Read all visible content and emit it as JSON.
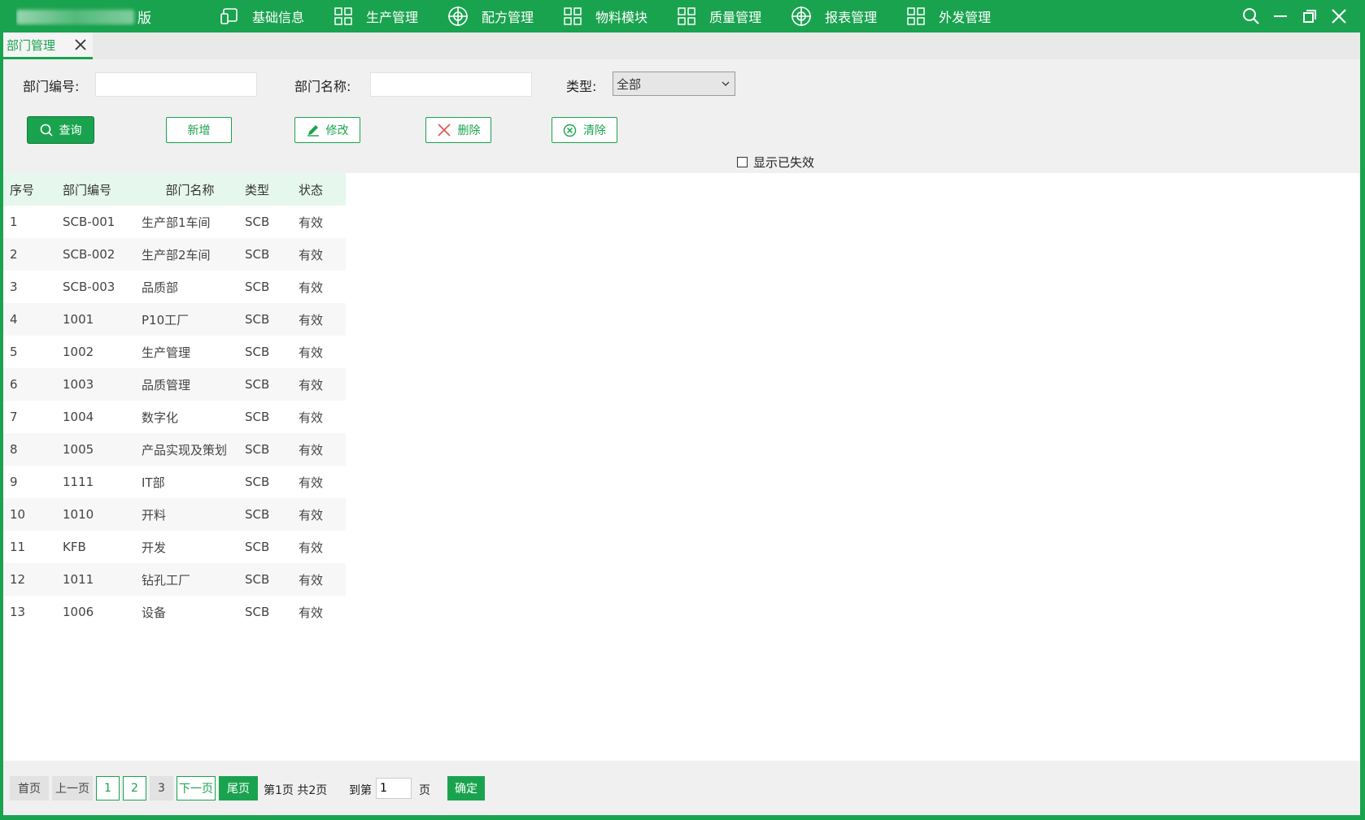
{
  "app": {
    "title_suffix": "版"
  },
  "menu": [
    {
      "label": "基础信息",
      "icon": "device-icon"
    },
    {
      "label": "生产管理",
      "icon": "grid-icon"
    },
    {
      "label": "配方管理",
      "icon": "target-icon"
    },
    {
      "label": "物料模块",
      "icon": "grid-icon"
    },
    {
      "label": "质量管理",
      "icon": "grid-icon"
    },
    {
      "label": "报表管理",
      "icon": "target-icon"
    },
    {
      "label": "外发管理",
      "icon": "grid-icon"
    }
  ],
  "tab": {
    "label": "部门管理"
  },
  "filter": {
    "dept_code_label": "部门编号:",
    "dept_code_value": "",
    "dept_name_label": "部门名称:",
    "dept_name_value": "",
    "type_label": "类型:",
    "type_value": "全部"
  },
  "buttons": {
    "query": "查询",
    "add": "新增",
    "edit": "修改",
    "delete": "删除",
    "clear": "清除"
  },
  "show_invalid_label": "显示已失效",
  "table": {
    "headers": [
      "序号",
      "部门编号",
      "部门名称",
      "类型",
      "状态"
    ],
    "rows": [
      [
        "1",
        "SCB-001",
        "生产部1车间",
        "SCB",
        "有效"
      ],
      [
        "2",
        "SCB-002",
        "生产部2车间",
        "SCB",
        "有效"
      ],
      [
        "3",
        "SCB-003",
        "品质部",
        "SCB",
        "有效"
      ],
      [
        "4",
        "1001",
        "P10工厂",
        "SCB",
        "有效"
      ],
      [
        "5",
        "1002",
        "生产管理",
        "SCB",
        "有效"
      ],
      [
        "6",
        "1003",
        "品质管理",
        "SCB",
        "有效"
      ],
      [
        "7",
        "1004",
        "数字化",
        "SCB",
        "有效"
      ],
      [
        "8",
        "1005",
        "产品实现及策划",
        "SCB",
        "有效"
      ],
      [
        "9",
        "1111",
        "IT部",
        "SCB",
        "有效"
      ],
      [
        "10",
        "1010",
        "开料",
        "SCB",
        "有效"
      ],
      [
        "11",
        "KFB",
        "开发",
        "SCB",
        "有效"
      ],
      [
        "12",
        "1011",
        "钻孔工厂",
        "SCB",
        "有效"
      ],
      [
        "13",
        "1006",
        "设备",
        "SCB",
        "有效"
      ]
    ]
  },
  "pager": {
    "first": "首页",
    "prev": "上一页",
    "pages": [
      "1",
      "2",
      "3"
    ],
    "next": "下一页",
    "last": "尾页",
    "info": "第1页 共2页",
    "goto_label": "到第",
    "goto_value": "1",
    "page_unit": "页",
    "confirm": "确定"
  },
  "colors": {
    "brand": "#1aa34f",
    "header_row": "#e6f7ee"
  }
}
